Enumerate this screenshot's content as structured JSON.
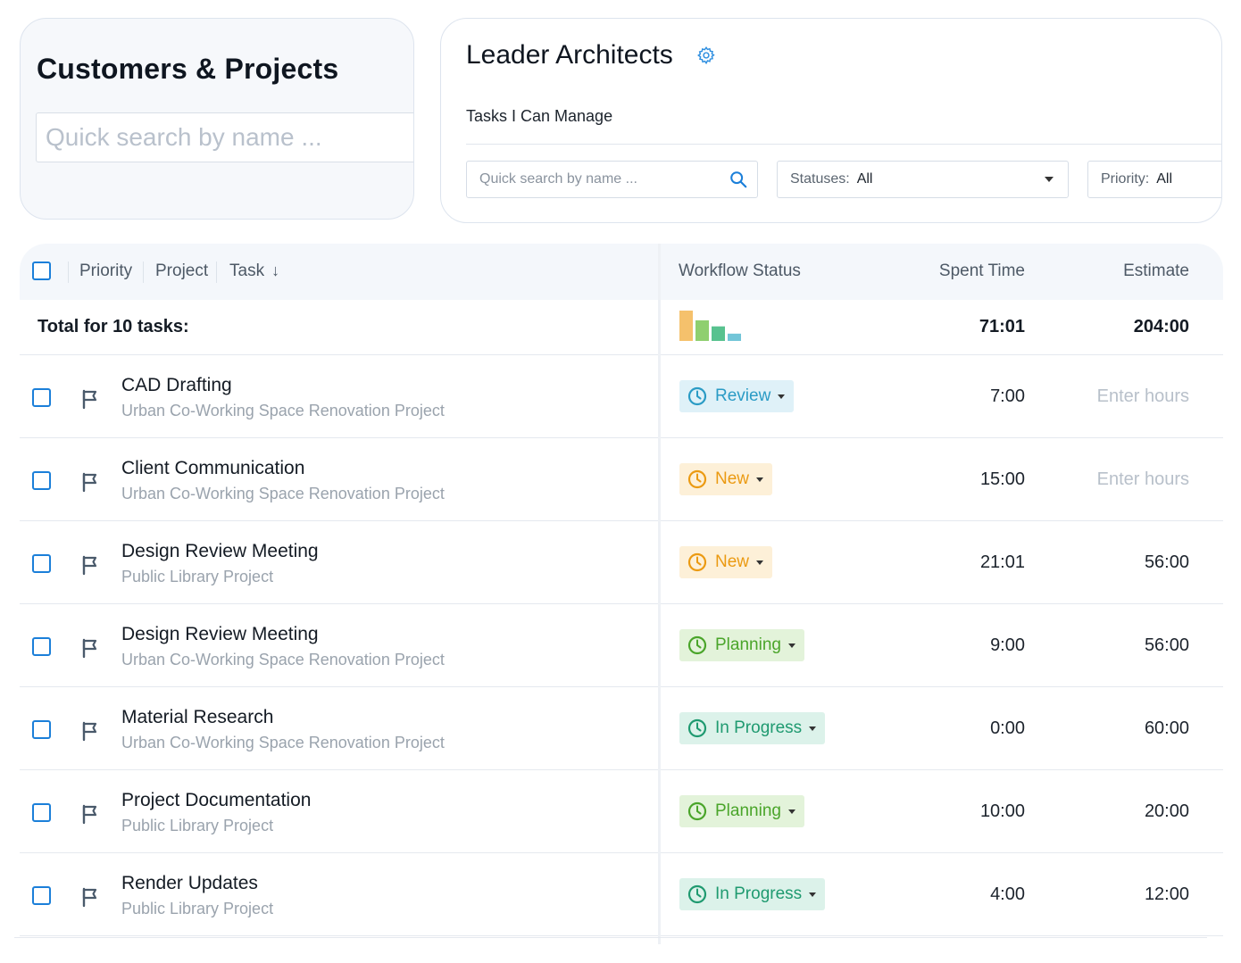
{
  "customers_panel": {
    "title": "Customers & Projects",
    "search_placeholder": "Quick search by name ..."
  },
  "team_panel": {
    "name": "Leader Architects",
    "subtitle": "Tasks I Can Manage",
    "search_placeholder": "Quick search by name ...",
    "statuses_label": "Statuses:",
    "statuses_value": "All",
    "priority_label": "Priority:",
    "priority_value": "All"
  },
  "table": {
    "headers": {
      "priority": "Priority",
      "project": "Project",
      "task": "Task",
      "sort_arrow": "↓",
      "workflow_status": "Workflow Status",
      "spent_time": "Spent Time",
      "estimate": "Estimate"
    },
    "total": {
      "label": "Total for 10 tasks:",
      "spent": "71:01",
      "estimate": "204:00",
      "status_distribution": [
        {
          "status": "New",
          "color": "#f5c16c",
          "level": 1.0
        },
        {
          "status": "Planning",
          "color": "#8fcf6f",
          "level": 0.68
        },
        {
          "status": "In Progress",
          "color": "#58c28f",
          "level": 0.48
        },
        {
          "status": "Review",
          "color": "#72c5d8",
          "level": 0.24
        }
      ]
    },
    "rows": [
      {
        "task": "CAD Drafting",
        "project": "Urban Co-Working Space Renovation Project",
        "status": "Review",
        "spent": "7:00",
        "estimate": "Enter hours",
        "estimate_is_placeholder": true
      },
      {
        "task": "Client Communication",
        "project": "Urban Co-Working Space Renovation Project",
        "status": "New",
        "spent": "15:00",
        "estimate": "Enter hours",
        "estimate_is_placeholder": true
      },
      {
        "task": "Design Review Meeting",
        "project": "Public Library Project",
        "status": "New",
        "spent": "21:01",
        "estimate": "56:00",
        "estimate_is_placeholder": false
      },
      {
        "task": "Design Review Meeting",
        "project": "Urban Co-Working Space Renovation Project",
        "status": "Planning",
        "spent": "9:00",
        "estimate": "56:00",
        "estimate_is_placeholder": false
      },
      {
        "task": "Material Research",
        "project": "Urban Co-Working Space Renovation Project",
        "status": "In Progress",
        "spent": "0:00",
        "estimate": "60:00",
        "estimate_is_placeholder": false
      },
      {
        "task": "Project Documentation",
        "project": "Public Library Project",
        "status": "Planning",
        "spent": "10:00",
        "estimate": "20:00",
        "estimate_is_placeholder": false
      },
      {
        "task": "Render Updates",
        "project": "Public Library Project",
        "status": "In Progress",
        "spent": "4:00",
        "estimate": "12:00",
        "estimate_is_placeholder": false
      }
    ]
  },
  "status_styles": {
    "Review": {
      "bg": "#dff1f8",
      "fg": "#2a9bc5"
    },
    "New": {
      "bg": "#fdf0d8",
      "fg": "#eb9a12"
    },
    "Planning": {
      "bg": "#e3f3da",
      "fg": "#4aa52a"
    },
    "In Progress": {
      "bg": "#dcf2ea",
      "fg": "#1f9a70"
    }
  },
  "icons": {
    "gear": "gear-icon",
    "search": "search-icon",
    "flag": "flag-icon",
    "status": "clock-icon",
    "caret": "caret-down-icon"
  },
  "colors": {
    "accent": "#1b7fd9",
    "flag": "#4a5a6b"
  }
}
